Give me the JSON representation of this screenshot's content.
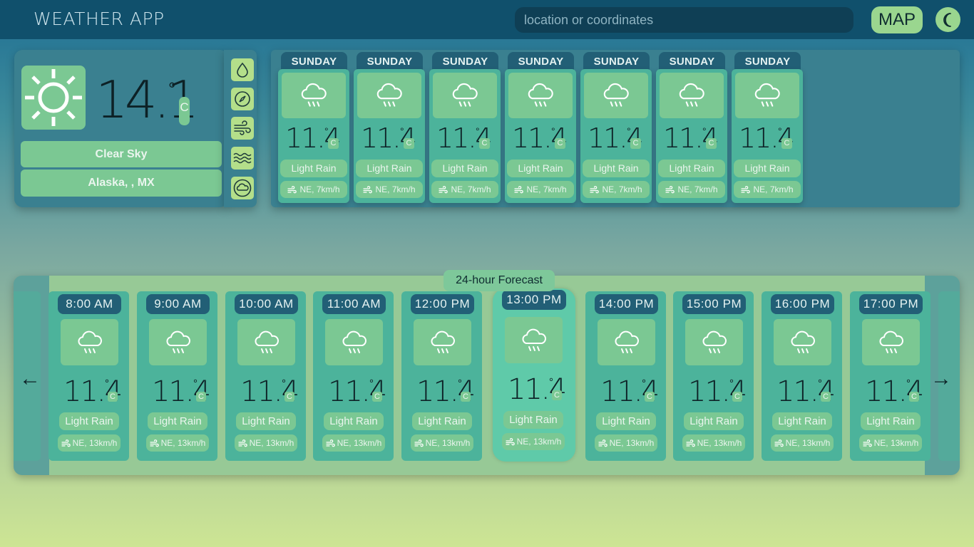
{
  "header": {
    "title": "WEATHER APP",
    "search_placeholder": "location or coordinates",
    "map_label": "MAP",
    "theme_icon": "moon-icon"
  },
  "current": {
    "temp": "14.1",
    "deg": "°",
    "unit": "C",
    "condition": "Clear Sky",
    "location": "Alaska, , MX",
    "icon": "sun-icon",
    "side_icons": [
      "droplet-icon",
      "compass-icon",
      "wind-icon",
      "waves-icon",
      "cloud-icon"
    ]
  },
  "daily": [
    {
      "day": "SUNDAY",
      "temp": "11.4",
      "deg": "°",
      "unit": "C",
      "condition": "Light Rain",
      "wind": "NE, 7km/h"
    },
    {
      "day": "SUNDAY",
      "temp": "11.4",
      "deg": "°",
      "unit": "C",
      "condition": "Light Rain",
      "wind": "NE, 7km/h"
    },
    {
      "day": "SUNDAY",
      "temp": "11.4",
      "deg": "°",
      "unit": "C",
      "condition": "Light Rain",
      "wind": "NE, 7km/h"
    },
    {
      "day": "SUNDAY",
      "temp": "11.4",
      "deg": "°",
      "unit": "C",
      "condition": "Light Rain",
      "wind": "NE, 7km/h"
    },
    {
      "day": "SUNDAY",
      "temp": "11.4",
      "deg": "°",
      "unit": "C",
      "condition": "Light Rain",
      "wind": "NE, 7km/h"
    },
    {
      "day": "SUNDAY",
      "temp": "11.4",
      "deg": "°",
      "unit": "C",
      "condition": "Light Rain",
      "wind": "NE, 7km/h"
    },
    {
      "day": "SUNDAY",
      "temp": "11.4",
      "deg": "°",
      "unit": "C",
      "condition": "Light Rain",
      "wind": "NE, 7km/h"
    }
  ],
  "hourly": {
    "title": "24-hour Forecast",
    "prev_arrow": "←",
    "next_arrow": "→",
    "items": [
      {
        "time": "8:00 AM",
        "temp": "11.4",
        "deg": "°",
        "unit": "C",
        "condition": "Light Rain",
        "wind": "NE, 13km/h"
      },
      {
        "time": "9:00 AM",
        "temp": "11.4",
        "deg": "°",
        "unit": "C",
        "condition": "Light Rain",
        "wind": "NE, 13km/h"
      },
      {
        "time": "10:00 AM",
        "temp": "11.4",
        "deg": "°",
        "unit": "C",
        "condition": "Light Rain",
        "wind": "NE, 13km/h"
      },
      {
        "time": "11:00 AM",
        "temp": "11.4",
        "deg": "°",
        "unit": "C",
        "condition": "Light Rain",
        "wind": "NE, 13km/h"
      },
      {
        "time": "12:00 PM",
        "temp": "11.4",
        "deg": "°",
        "unit": "C",
        "condition": "Light Rain",
        "wind": "NE, 13km/h"
      },
      {
        "time": "13:00 PM",
        "temp": "11.4",
        "deg": "°",
        "unit": "C",
        "condition": "Light Rain",
        "wind": "NE, 13km/h",
        "active": true
      },
      {
        "time": "14:00 PM",
        "temp": "11.4",
        "deg": "°",
        "unit": "C",
        "condition": "Light Rain",
        "wind": "NE, 13km/h"
      },
      {
        "time": "15:00 PM",
        "temp": "11.4",
        "deg": "°",
        "unit": "C",
        "condition": "Light Rain",
        "wind": "NE, 13km/h"
      },
      {
        "time": "16:00 PM",
        "temp": "11.4",
        "deg": "°",
        "unit": "C",
        "condition": "Light Rain",
        "wind": "NE, 13km/h"
      },
      {
        "time": "17:00 PM",
        "temp": "11.4",
        "deg": "°",
        "unit": "C",
        "condition": "Light Rain",
        "wind": "NE, 13km/h"
      }
    ]
  },
  "colors": {
    "header_bg": "#10506c",
    "accent_green": "#7bc893",
    "card_teal": "#4cb39b",
    "tab_dark": "#225f76"
  }
}
